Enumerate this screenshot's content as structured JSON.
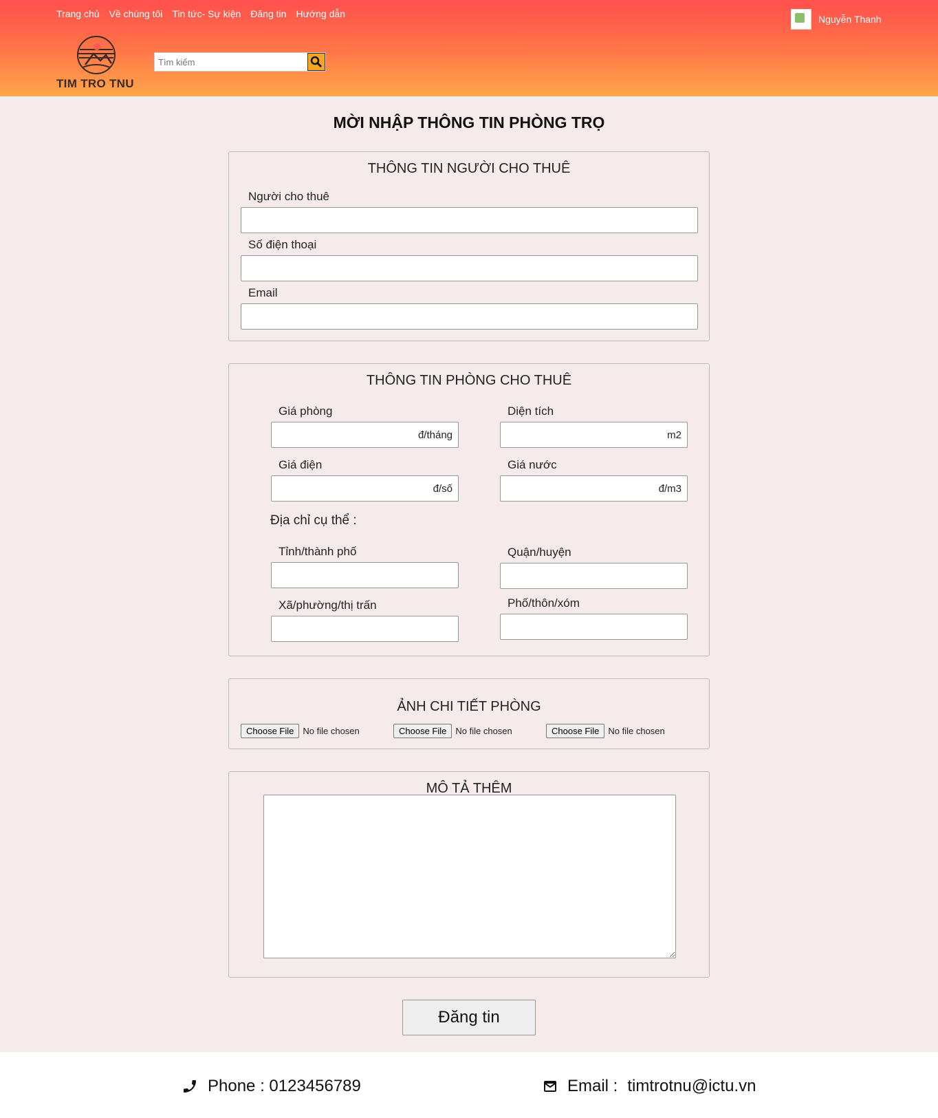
{
  "header": {
    "nav": [
      "Trang chủ",
      "Về chúng tôi",
      "Tin tức- Sự kiện",
      "Đăng tin",
      "Hướng dẫn"
    ],
    "logo_text": "TIM TRO TNU",
    "search_placeholder": "Tìm kiếm",
    "username": "Nguyễn Thanh"
  },
  "page_title": "MỜI NHẬP THÔNG TIN PHÒNG TRỌ",
  "landlord": {
    "legend": "THÔNG TIN NGƯỜI CHO THUÊ",
    "name_label": "Người cho thuê",
    "phone_label": "Số điện thoại",
    "email_label": "Email"
  },
  "room": {
    "legend": "THÔNG TIN PHÒNG CHO THUÊ",
    "price_label": "Giá phòng",
    "price_unit": "đ/tháng",
    "area_label": "Diện tích",
    "area_unit": "m2",
    "electric_label": "Giá điện",
    "electric_unit": "đ/số",
    "water_label": "Giá nước",
    "water_unit": "đ/m3",
    "address_label": "Địa chỉ cụ thể :",
    "province_label": "Tỉnh/thành phố",
    "district_label": "Quận/huyện",
    "ward_label": "Xã/phường/thị trấn",
    "street_label": "Phố/thôn/xóm"
  },
  "photos": {
    "legend": "ẢNH CHI TIẾT PHÒNG",
    "choose_label": "Choose File",
    "no_file": "No file chosen"
  },
  "description": {
    "legend": "MÔ TẢ THÊM"
  },
  "submit_label": "Đăng tin",
  "footer": {
    "phone": "Phone : 0123456789",
    "email_label": "Email :",
    "email": "timtrotnu@ictu.vn"
  },
  "colors": {
    "header_top": "#ff4f4d",
    "header_bottom": "#ffa74a",
    "page_bg": "#f5ebea",
    "search_button": "#f5a623"
  }
}
